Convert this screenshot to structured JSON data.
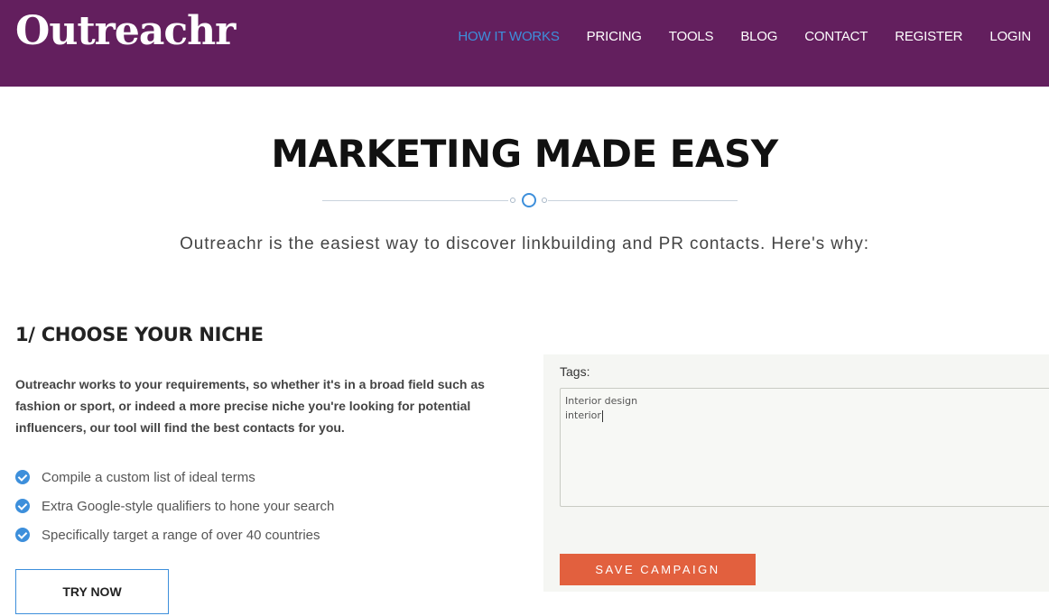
{
  "brand": {
    "logo": "Outreachr"
  },
  "nav": {
    "items": [
      {
        "label": "HOW IT WORKS",
        "active": true
      },
      {
        "label": "PRICING"
      },
      {
        "label": "TOOLS"
      },
      {
        "label": "BLOG"
      },
      {
        "label": "CONTACT"
      },
      {
        "label": "REGISTER"
      },
      {
        "label": "LOGIN"
      }
    ]
  },
  "hero": {
    "title": "MARKETING MADE EASY",
    "subtitle": "Outreachr is the easiest way to discover linkbuilding and PR contacts. Here's why:"
  },
  "section": {
    "title": "1/ CHOOSE YOUR NICHE",
    "description": "Outreachr works to your requirements, so whether it's in a broad field such as fashion or sport, or indeed a more precise niche you're looking for potential influencers, our tool will find the best contacts for you.",
    "features": [
      "Compile a custom list of ideal terms",
      "Extra Google-style qualifiers to hone your search",
      "Specifically target a range of over 40 countries"
    ],
    "cta_label": "TRY NOW"
  },
  "demo": {
    "tags_label": "Tags:",
    "tags_lines": [
      "Interior design",
      "interior"
    ],
    "save_label": "SAVE CAMPAIGN"
  },
  "colors": {
    "header_bg": "#631f5e",
    "accent_blue": "#3d8fdb",
    "save_button": "#e2603e"
  }
}
